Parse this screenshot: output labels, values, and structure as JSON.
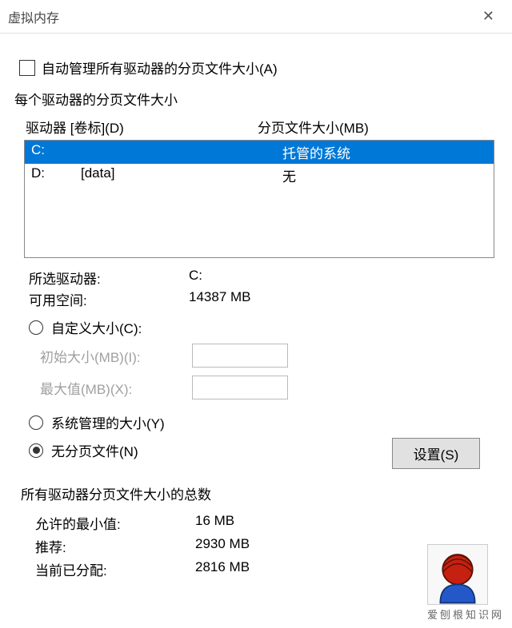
{
  "window": {
    "title": "虚拟内存"
  },
  "auto_manage": {
    "label": "自动管理所有驱动器的分页文件大小(A)",
    "checked": false
  },
  "per_drive": {
    "legend": "每个驱动器的分页文件大小",
    "col_drive": "驱动器 [卷标](D)",
    "col_size": "分页文件大小(MB)",
    "rows": [
      {
        "drive": "C:",
        "label": "",
        "size": "托管的系统",
        "selected": true
      },
      {
        "drive": "D:",
        "label": "[data]",
        "size": "无",
        "selected": false
      }
    ]
  },
  "selected_drive": {
    "label": "所选驱动器:",
    "value": "C:"
  },
  "free_space": {
    "label": "可用空间:",
    "value": "14387 MB"
  },
  "custom_size": {
    "label": "自定义大小(C):",
    "initial_label": "初始大小(MB)(I):",
    "initial_value": "",
    "max_label": "最大值(MB)(X):",
    "max_value": ""
  },
  "system_managed": {
    "label": "系统管理的大小(Y)"
  },
  "no_paging": {
    "label": "无分页文件(N)"
  },
  "set_button": "设置(S)",
  "totals": {
    "legend": "所有驱动器分页文件大小的总数",
    "min_label": "允许的最小值:",
    "min_value": "16 MB",
    "rec_label": "推荐:",
    "rec_value": "2930 MB",
    "cur_label": "当前已分配:",
    "cur_value": "2816 MB"
  },
  "watermark": "爱刨根知识网"
}
